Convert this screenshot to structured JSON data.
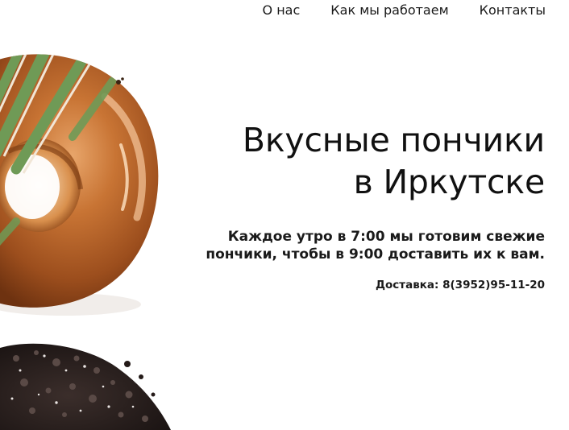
{
  "nav": {
    "items": [
      {
        "label": "О нас"
      },
      {
        "label": "Как мы работаем"
      },
      {
        "label": "Контакты"
      }
    ]
  },
  "hero": {
    "title_line1": "Вкусные пончики",
    "title_line2": "в Иркутске",
    "desc_line1": "Каждое утро в 7:00 мы готовим свежие",
    "desc_line2": "пончики, чтобы в 9:00 доставить их к вам.",
    "delivery": "Доставка: 8(3952)95-11-20"
  },
  "colors": {
    "text": "#111111",
    "background": "#ffffff",
    "glaze": "#b8652a",
    "stripe_green": "#6f9a56",
    "chocolate": "#2a211f"
  },
  "images": {
    "top": "glazed-donut-image",
    "bottom": "chocolate-cookie-donut-image"
  }
}
